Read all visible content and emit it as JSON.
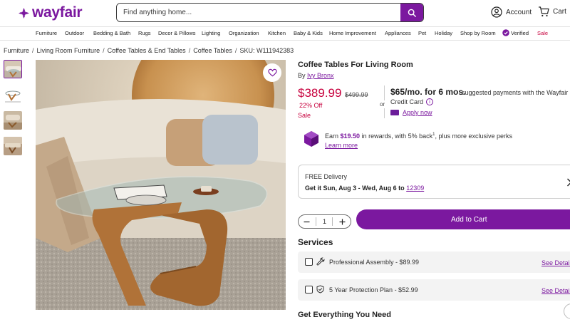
{
  "header": {
    "logo_text": "wayfair",
    "search_placeholder": "Find anything home...",
    "account_label": "Account",
    "cart_label": "Cart"
  },
  "nav": {
    "items": [
      "Furniture",
      "Outdoor",
      "Bedding & Bath",
      "Rugs",
      "Decor & Pillows",
      "Lighting",
      "Organization",
      "Kitchen",
      "Baby & Kids",
      "Home Improvement",
      "Appliances",
      "Pet",
      "Holiday",
      "Shop by Room"
    ],
    "verified_label": "Verified",
    "sale_label": "Sale"
  },
  "breadcrumb": {
    "items": [
      "Furniture",
      "Living Room Furniture",
      "Coffee Tables & End Tables",
      "Coffee Tables"
    ],
    "sku": "SKU: W111942383"
  },
  "product": {
    "title": "Coffee Tables For Living Room",
    "by_prefix": "By",
    "brand": "Ivy Bronx",
    "price": "$389.99",
    "original_price": "$499.99",
    "discount": "22% Off",
    "sale_label": "Sale",
    "or_label": "or",
    "monthly": "$65/mo. for 6 mos.",
    "monthly_desc": "suggested payments with the Wayfair",
    "credit_card": "Credit Card",
    "apply_now": "Apply now"
  },
  "rewards": {
    "earn_prefix": "Earn",
    "amount": "$19.50",
    "earn_suffix": "in rewards, with 5% back",
    "sup": "1",
    "more": ", plus more exclusive perks",
    "learn_more": "Learn more"
  },
  "delivery": {
    "title": "FREE Delivery",
    "date_text": "Get it Sun, Aug 3 - Wed, Aug 6 to",
    "zip": "12309"
  },
  "purchase": {
    "quantity": "1",
    "add_to_cart": "Add to Cart"
  },
  "services": {
    "heading": "Services",
    "items": [
      {
        "label": "Professional Assembly - $89.99",
        "link": "See Details"
      },
      {
        "label": "5 Year Protection Plan - $52.99",
        "link": "See Details"
      }
    ]
  },
  "section_heading": "Get Everything You Need",
  "colors": {
    "brand": "#7b189f",
    "sale": "#c7003d"
  }
}
